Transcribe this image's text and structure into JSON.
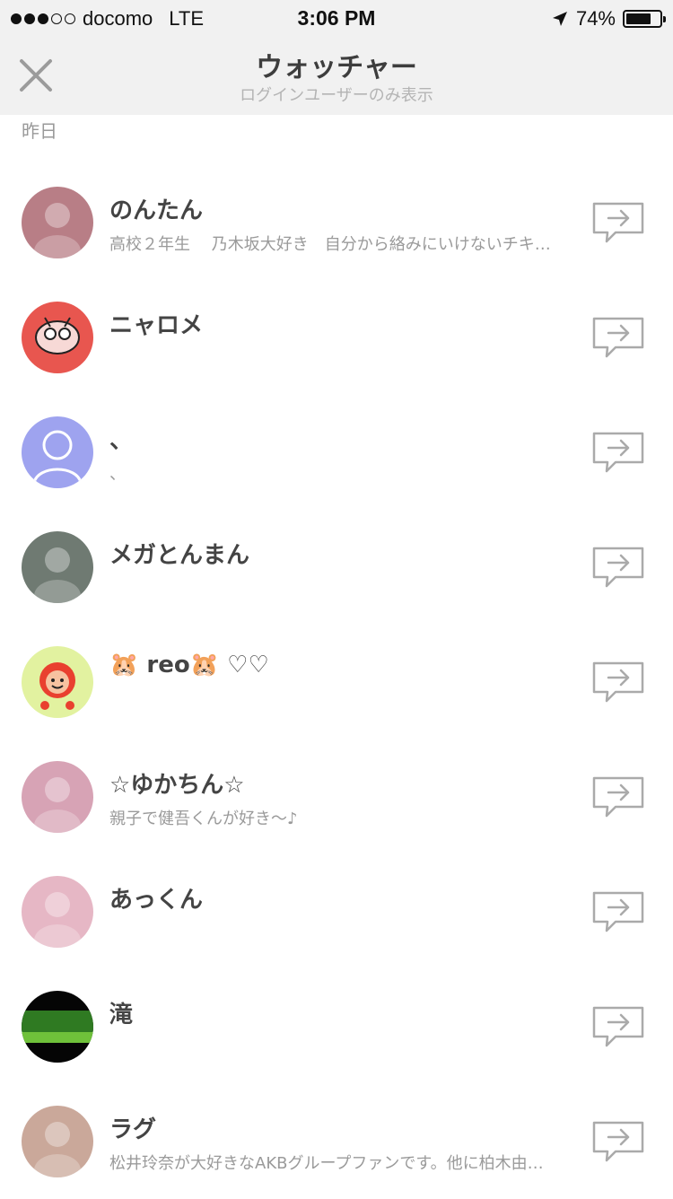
{
  "status_bar": {
    "carrier": "docomo",
    "network": "LTE",
    "time": "3:06 PM",
    "battery": "74%",
    "battery_level": 0.74,
    "signal_bars": 3,
    "signal_total": 5,
    "location_icon": "location-arrow-icon"
  },
  "nav": {
    "title": "ウォッチャー",
    "subtitle": "ログインユーザーのみ表示",
    "close_icon": "close-icon"
  },
  "section": {
    "label": "昨日"
  },
  "users": [
    {
      "name": "のんたん",
      "bio": "高校２年生　 乃木坂大好き　自分から絡みにいけないチキ…",
      "avatar": "photo-avatar",
      "avatar_color": "#b87e86"
    },
    {
      "name": "ニャロメ",
      "bio": "",
      "avatar": "cartoon-cat-avatar",
      "avatar_color": "#e8564f"
    },
    {
      "name": "、",
      "bio": "、",
      "avatar": "default-person-avatar",
      "avatar_color": "#9ea3ef"
    },
    {
      "name": "メガとんまん",
      "bio": "",
      "avatar": "photo-avatar",
      "avatar_color": "#6f7a72"
    },
    {
      "name": "🐹 reo🐹 ♡♡",
      "bio": "",
      "avatar": "cartoon-mascot-avatar",
      "avatar_color": "#e2f2a0"
    },
    {
      "name": "☆ゆかちん☆",
      "bio": "親子で健吾くんが好き〜♪",
      "avatar": "photo-avatar",
      "avatar_color": "#d7a3b5"
    },
    {
      "name": "あっくん",
      "bio": "",
      "avatar": "photo-avatar",
      "avatar_color": "#e6b7c5"
    },
    {
      "name": "滝",
      "bio": "",
      "avatar": "forest-photo-avatar",
      "avatar_color": "#2f7a22"
    },
    {
      "name": "ラグ",
      "bio": "松井玲奈が大好きなAKBグループファンです。他に柏木由…",
      "avatar": "photo-avatar",
      "avatar_color": "#caa89a"
    }
  ],
  "row_action_icon": "message-arrow-icon",
  "colors": {
    "bar_bg": "#f1f1f1",
    "text": "#444444",
    "muted": "#9a9a9a",
    "icon": "#aaaaaa"
  }
}
